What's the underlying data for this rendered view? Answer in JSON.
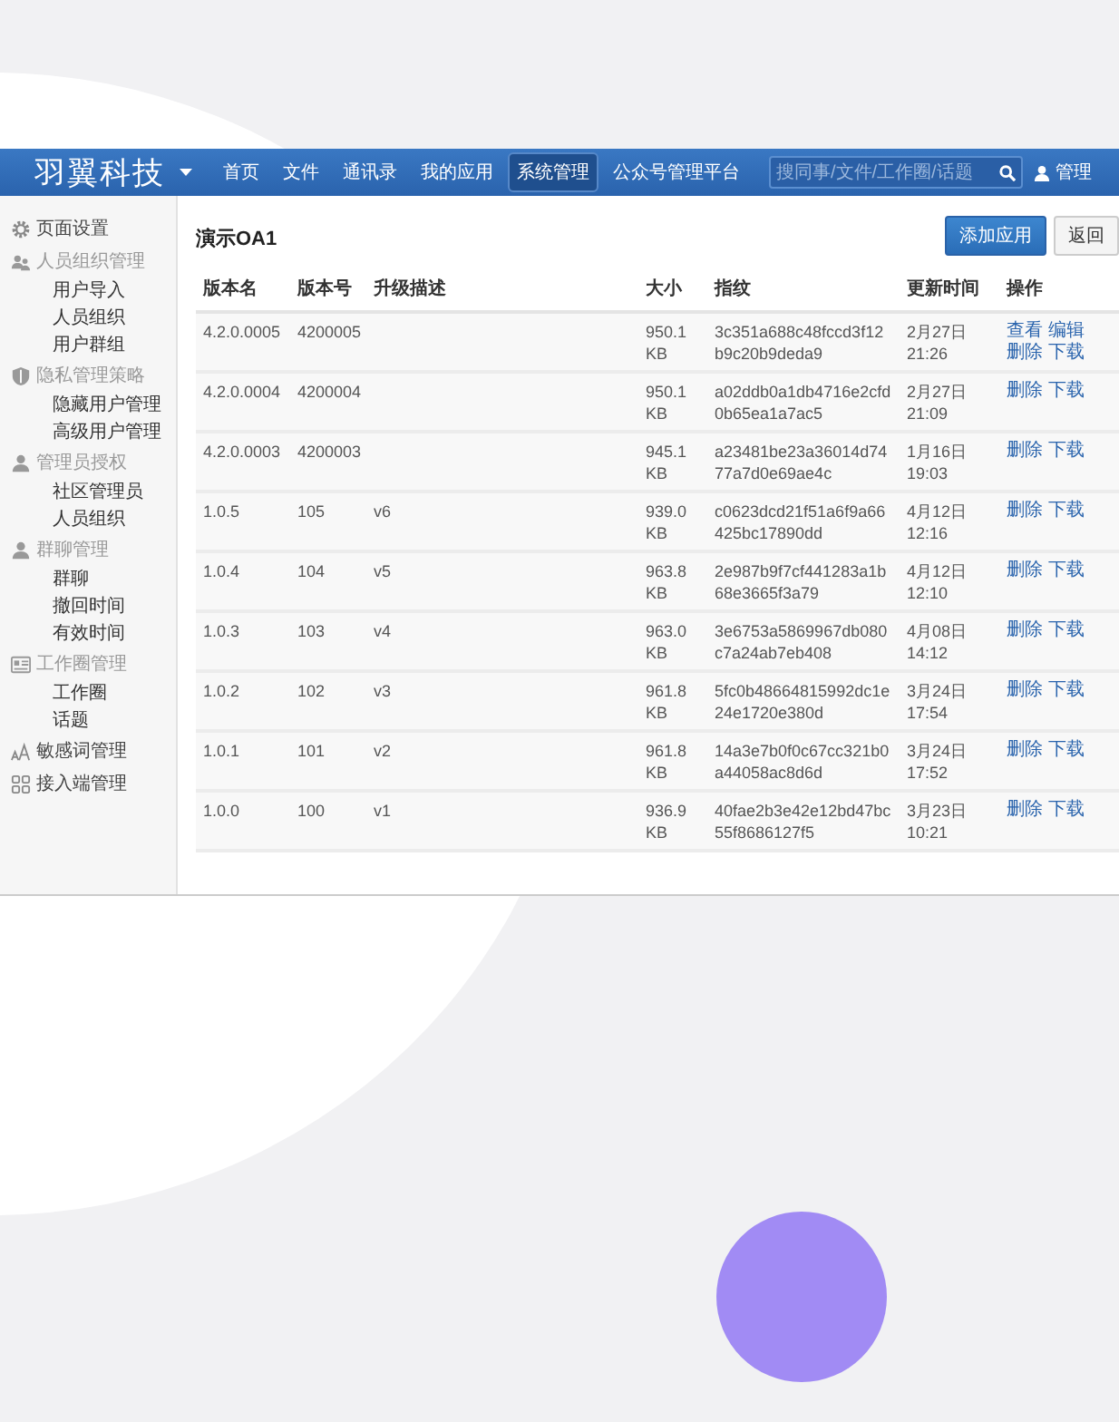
{
  "navbar": {
    "logo": "羽翼科技",
    "nav": [
      {
        "label": "首页",
        "selected": false
      },
      {
        "label": "文件",
        "selected": false
      },
      {
        "label": "通讯录",
        "selected": false
      },
      {
        "label": "我的应用",
        "selected": false
      },
      {
        "label": "系统管理",
        "selected": true
      },
      {
        "label": "公众号管理平台",
        "selected": false
      }
    ],
    "search": {
      "placeholder": "搜同事/文件/工作圈/话题"
    },
    "user": "管理"
  },
  "sidebar": {
    "items": [
      {
        "label": "页面设置",
        "kind": "link"
      },
      {
        "label": "人员组织管理",
        "kind": "group",
        "children": [
          {
            "label": "用户导入"
          },
          {
            "label": "人员组织"
          },
          {
            "label": "用户群组"
          }
        ]
      },
      {
        "label": "隐私管理策略",
        "kind": "group",
        "children": [
          {
            "label": "隐藏用户管理"
          },
          {
            "label": "高级用户管理"
          }
        ]
      },
      {
        "label": "管理员授权",
        "kind": "group",
        "children": [
          {
            "label": "社区管理员"
          },
          {
            "label": "人员组织"
          }
        ]
      },
      {
        "label": "群聊管理",
        "kind": "group",
        "children": [
          {
            "label": "群聊"
          },
          {
            "label": "撤回时间"
          },
          {
            "label": "有效时间"
          }
        ]
      },
      {
        "label": "工作圈管理",
        "kind": "group",
        "children": [
          {
            "label": "工作圈"
          },
          {
            "label": "话题"
          }
        ]
      },
      {
        "label": "敏感词管理",
        "kind": "link"
      },
      {
        "label": "接入端管理",
        "kind": "link"
      }
    ]
  },
  "content": {
    "title": "演示OA1",
    "buttons": [
      {
        "label": "添加应用",
        "kind": "primary"
      },
      {
        "label": "返回",
        "kind": "default"
      }
    ],
    "table": {
      "columns": [
        "版本名",
        "版本号",
        "升级描述",
        "大小",
        "指纹",
        "更新时间",
        "操作"
      ],
      "rows": [
        {
          "version_name": "4.2.0.0005",
          "version_code": "4200005",
          "size": "950.1 KB",
          "fingerprint": "3c351a688c48fccd3f12b9c20b9deda9",
          "updated": "2月27日 21:26",
          "actions": [
            "查看",
            "编辑",
            "删除",
            "下载"
          ]
        },
        {
          "version_name": "4.2.0.0004",
          "version_code": "4200004",
          "size": "950.1 KB",
          "fingerprint": "a02ddb0a1db4716e2cfd0b65ea1a7ac5",
          "updated": "2月27日 21:09",
          "actions": [
            "删除",
            "下载"
          ]
        },
        {
          "version_name": "4.2.0.0003",
          "version_code": "4200003",
          "size": "945.1 KB",
          "fingerprint": "a23481be23a36014d7477a7d0e69ae4c",
          "updated": "1月16日 19:03",
          "actions": [
            "删除",
            "下载"
          ]
        },
        {
          "version_name": "1.0.5",
          "version_code": "105",
          "description": "v6",
          "size": "939.0 KB",
          "fingerprint": "c0623dcd21f51a6f9a66425bc17890dd",
          "updated": "4月12日 12:16",
          "actions": [
            "删除",
            "下载"
          ]
        },
        {
          "version_name": "1.0.4",
          "version_code": "104",
          "description": "v5",
          "size": "963.8 KB",
          "fingerprint": "2e987b9f7cf441283a1b68e3665f3a79",
          "updated": "4月12日 12:10",
          "actions": [
            "删除",
            "下载"
          ]
        },
        {
          "version_name": "1.0.3",
          "version_code": "103",
          "description": "v4",
          "size": "963.0 KB",
          "fingerprint": "3e6753a5869967db080c7a24ab7eb408",
          "updated": "4月08日 14:12",
          "actions": [
            "删除",
            "下载"
          ]
        },
        {
          "version_name": "1.0.2",
          "version_code": "102",
          "description": "v3",
          "size": "961.8 KB",
          "fingerprint": "5fc0b48664815992dc1e24e1720e380d",
          "updated": "3月24日 17:54",
          "actions": [
            "删除",
            "下载"
          ]
        },
        {
          "version_name": "1.0.1",
          "version_code": "101",
          "description": "v2",
          "size": "961.8 KB",
          "fingerprint": "14a3e7b0f0c67cc321b0a44058ac8d6d",
          "updated": "3月24日 17:52",
          "actions": [
            "删除",
            "下载"
          ]
        },
        {
          "version_name": "1.0.0",
          "version_code": "100",
          "description": "v1",
          "size": "936.9 KB",
          "fingerprint": "40fae2b3e42e12bd47bc55f8686127f5",
          "updated": "3月23日 10:21",
          "actions": [
            "删除",
            "下载"
          ]
        }
      ]
    }
  }
}
